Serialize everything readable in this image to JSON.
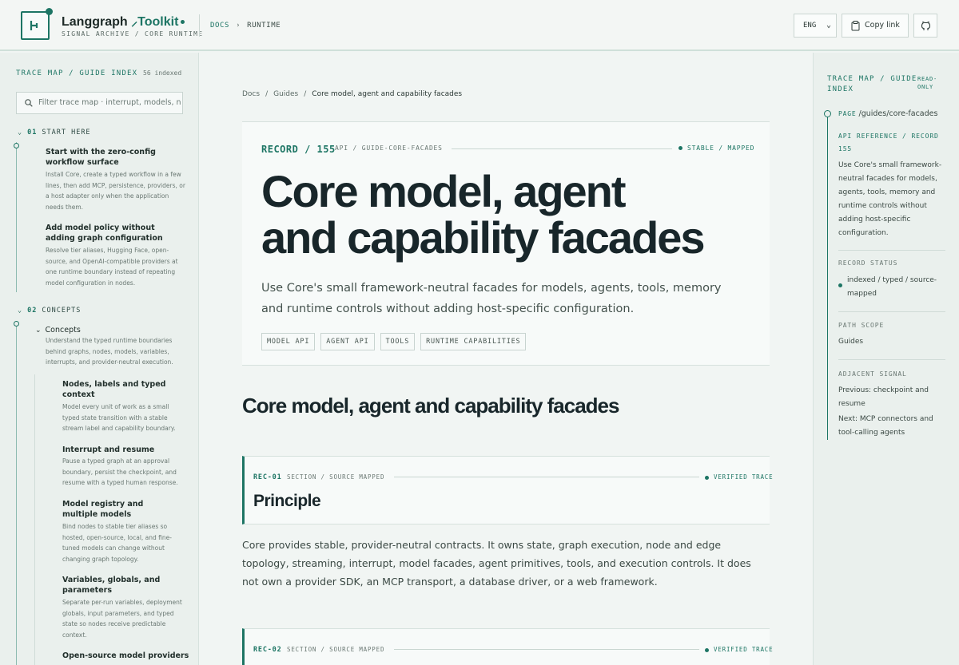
{
  "header": {
    "brand": "Langgraph",
    "brand_accent": "Toolkit",
    "subtitle": "SIGNAL ARCHIVE / CORE RUNTIME",
    "breadcrumb": [
      "DOCS",
      "RUNTIME"
    ],
    "lang": "ENG",
    "copy_label": "Copy link"
  },
  "left": {
    "title": "TRACE MAP / GUIDE INDEX",
    "count": "56 indexed",
    "search_placeholder": "Filter trace map · interrupt, models, n",
    "sections": [
      {
        "num": "01",
        "label": "START HERE"
      },
      {
        "num": "02",
        "label": "CONCEPTS"
      }
    ],
    "items": [
      {
        "title": "Start with the zero-config workflow surface",
        "desc": "Install Core, create a typed workflow in a few lines, then add MCP, persistence, providers, or a host adapter only when the application needs them."
      },
      {
        "title": "Add model policy without adding graph configuration",
        "desc": "Resolve tier aliases, Hugging Face, open-source, and OpenAI-compatible providers at one runtime boundary instead of repeating model configuration in nodes."
      },
      {
        "title": "Concepts",
        "desc": "Understand the typed runtime boundaries behind graphs, nodes, models, variables, interrupts, and provider-neutral execution."
      },
      {
        "title": "Nodes, labels and typed context",
        "desc": "Model every unit of work as a small typed state transition with a stable stream label and capability boundary."
      },
      {
        "title": "Interrupt and resume",
        "desc": "Pause a typed graph at an approval boundary, persist the checkpoint, and resume with a typed human response."
      },
      {
        "title": "Model registry and multiple models",
        "desc": "Bind nodes to stable tier aliases so hosted, open-source, local, and fine-tuned models can change without changing graph topology."
      },
      {
        "title": "Variables, globals, and parameters",
        "desc": "Separate per-run variables, deployment globals, input parameters, and typed state so nodes receive predictable context."
      },
      {
        "title": "Open-source model providers",
        "desc": ""
      }
    ]
  },
  "main": {
    "breadcrumb": [
      "Docs",
      "Guides",
      "Core model, agent and capability facades"
    ],
    "record_id": "RECORD / 155",
    "record_path": "API / GUIDE-CORE-FACADES",
    "record_status": "STABLE / MAPPED",
    "title": "Core model, agent and capability facades",
    "lead": "Use Core's small framework-neutral facades for models, agents, tools, memory and runtime controls without adding host-specific configuration.",
    "tags": [
      "MODEL API",
      "AGENT API",
      "TOOLS",
      "RUNTIME CAPABILITIES"
    ],
    "section_heading": "Core model, agent and capability facades",
    "records": [
      {
        "id": "REC-01",
        "path": "SECTION / SOURCE MAPPED",
        "status": "VERIFIED TRACE",
        "title": "Principle"
      },
      {
        "id": "REC-02",
        "path": "SECTION / SOURCE MAPPED",
        "status": "VERIFIED TRACE",
        "title": ""
      }
    ],
    "paragraph": "Core provides stable, provider-neutral contracts. It owns state, graph execution, node and edge topology, streaming, interrupt, model facades, agent primitives, tools, and execution controls. It does not own a provider SDK, an MCP transport, a database driver, or a web framework."
  },
  "right": {
    "title": "TRACE MAP / GUIDE INDEX",
    "badge": "READ-ONLY",
    "page_label": "PAGE",
    "page_path": "/guides/core-facades",
    "api_ref": "API REFERENCE / RECORD 155",
    "api_desc": "Use Core's small framework-neutral facades for models, agents, tools, memory and runtime controls without adding host-specific configuration.",
    "status_label": "RECORD STATUS",
    "status_value": "indexed / typed / source-mapped",
    "scope_label": "PATH SCOPE",
    "scope_value": "Guides",
    "adjacent_label": "ADJACENT SIGNAL",
    "previous": "Previous: checkpoint and resume",
    "next": "Next: MCP connectors and tool-calling agents"
  },
  "colors": {
    "accent": "#1d7564",
    "background": "#f1f5f3",
    "sidebar": "#eaf0ed"
  }
}
